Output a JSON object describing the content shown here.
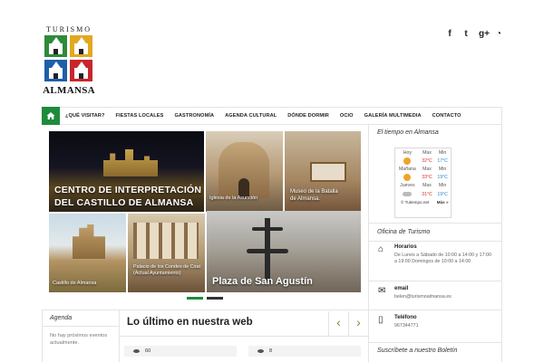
{
  "logo": {
    "top_text": "TURISMO",
    "bottom_text": "ALMANSA"
  },
  "social": {
    "facebook": "f",
    "twitter": "t",
    "googleplus": "g+",
    "rss": "rss"
  },
  "nav": {
    "items": [
      "¿QUÉ VISITAR?",
      "FIESTAS LOCALES",
      "GASTRONOMÍA",
      "AGENDA CULTURAL",
      "DÓNDE DORMIR",
      "OCIO",
      "GALERÍA MULTIMEDIA",
      "CONTACTO"
    ]
  },
  "slider": {
    "tiles": [
      "CENTRO DE INTERPRETACIÓN DEL CASTILLO DE ALMANSA",
      "Iglesia de la Asunción",
      "Museo de la Batalla de Almansa.",
      "Castillo de Almansa",
      "Palacio de los Condes de Cirat (Actual Ayuntamiento)",
      "Plaza de San Agustín"
    ]
  },
  "weather": {
    "title": "El tiempo en Almansa",
    "headers": [
      "Hoy",
      "Max",
      "Min"
    ],
    "rows": [
      {
        "day": "Hoy",
        "max": "32°C",
        "min": "17°C"
      },
      {
        "day": "Mañana",
        "max": "",
        "min": ""
      },
      {
        "day": "",
        "max": "33°C",
        "min": "19°C"
      },
      {
        "day": "Jueves",
        "max": "Max",
        "min": "Min"
      },
      {
        "day": "",
        "max": "31°C",
        "min": "19°C"
      }
    ],
    "day_headers": {
      "d1": "Hoy",
      "d2": "Mañana",
      "d3": "Jueves"
    },
    "temps": {
      "max1": "32°C",
      "min1": "17°C",
      "max2": "33°C",
      "min2": "19°C",
      "max3": "31°C",
      "min3": "19°C"
    },
    "col": {
      "max": "Max",
      "min": "Min"
    },
    "source": "© Tutiempo.net",
    "more": "Más »"
  },
  "office": {
    "title": "Oficina de Turismo",
    "hours_label": "Horarios",
    "hours_value": "De Lunes a Sábado de 10:00 a 14:00 y 17:00 a 19:00 Domingos de 10:00 a 14:00",
    "email_label": "email",
    "email_value": "belen@turismoalmansa.es",
    "phone_label": "Teléfono",
    "phone_value": "967344771"
  },
  "newsletter": {
    "title": "Suscríbete a nuestro Boletín"
  },
  "agenda": {
    "title": "Agenda",
    "empty": "No hay próximos eventos actualmente."
  },
  "latest": {
    "title": "Lo último en nuestra web",
    "views": [
      "60",
      "8"
    ]
  },
  "colors": {
    "accent": "#1e8b3c",
    "arrow": "#6a9a2e"
  }
}
